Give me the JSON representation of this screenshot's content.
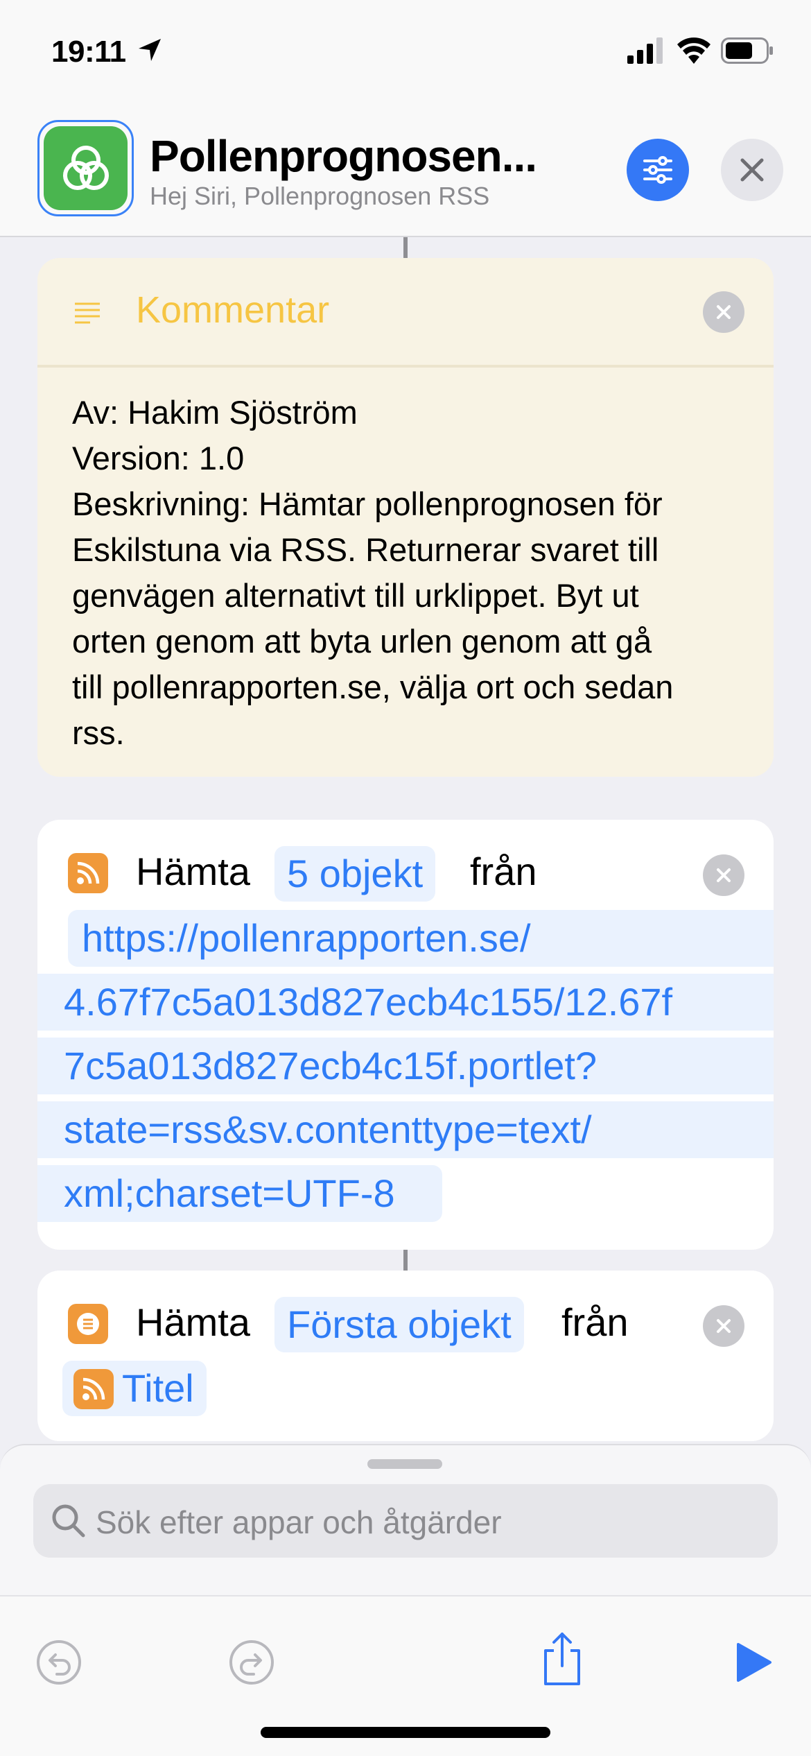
{
  "status_bar": {
    "time": "19:11",
    "icons": [
      "location-arrow-icon",
      "cellular-signal-icon",
      "wifi-icon",
      "battery-icon"
    ]
  },
  "header": {
    "title": "Pollenprognosen...",
    "subtitle": "Hej Siri, Pollenprognosen RSS",
    "app_icon": "shortcut-glyph-icon",
    "app_icon_color": "#4ab54f",
    "accent": "#3478f6"
  },
  "comment": {
    "label": "Kommentar",
    "lines": [
      "Av: Hakim Sjöström",
      "Version: 1.0",
      "Beskrivning: Hämtar pollenprognosen för",
      "Eskilstuna via RSS. Returnerar svaret till",
      "genvägen alternativt till urklippet. Byt ut",
      "orten genom att byta urlen genom att gå",
      "till pollenrapporten.se, välja ort och sedan",
      "rss."
    ]
  },
  "action1": {
    "verb": "Hämta",
    "count_token": "5 objekt",
    "preposition": "från",
    "url_lines": [
      "https://pollenrapporten.se/",
      "4.67f7c5a013d827ecb4c155/12.67f",
      "7c5a013d827ecb4c15f.portlet?",
      "state=rss&sv.contenttype=text/",
      "xml;charset=UTF-8"
    ]
  },
  "action2": {
    "verb": "Hämta",
    "item_token": "Första objekt",
    "preposition": "från",
    "source_token": "Titel"
  },
  "search": {
    "placeholder": "Sök efter appar och åtgärder"
  },
  "toolbar": {
    "icons": [
      "undo-icon",
      "redo-icon",
      "share-icon",
      "play-icon"
    ]
  }
}
